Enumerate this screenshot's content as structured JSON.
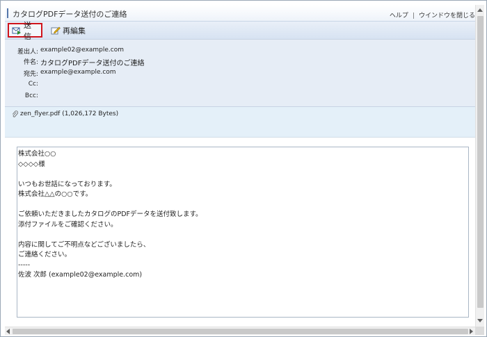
{
  "window": {
    "title": "カタログPDFデータ送付のご連絡",
    "links": {
      "help": "ヘルプ",
      "separator": "|",
      "close": "ウインドウを閉じる"
    }
  },
  "toolbar": {
    "send_label": "送信",
    "send_icon": "send-mail-icon",
    "reedit_label": "再編集",
    "reedit_icon": "edit-pencil-icon",
    "highlight_color": "#d0141c"
  },
  "headers": {
    "from_label": "差出人:",
    "from_value": "example02@example.com",
    "subject_label": "件名:",
    "subject_value": "カタログPDFデータ送付のご連絡",
    "to_label": "宛先:",
    "to_value": "example@example.com",
    "cc_label": "Cc:",
    "cc_value": "",
    "bcc_label": "Bcc:",
    "bcc_value": ""
  },
  "attachment": {
    "icon": "paperclip-icon",
    "name": "zen_flyer.pdf (1,026,172 Bytes)"
  },
  "message": {
    "lines": [
      "株式会社○○",
      "◇◇◇◇様",
      "",
      "いつもお世話になっております。",
      "株式会社△△の○○です。",
      "",
      "ご依頼いただきましたカタログのPDFデータを送付致します。",
      "添付ファイルをご確認ください。",
      "",
      "内容に関してご不明点などございましたら、",
      "ご連絡ください。",
      "-----",
      "佐波 次郎 (example02@example.com)"
    ]
  }
}
